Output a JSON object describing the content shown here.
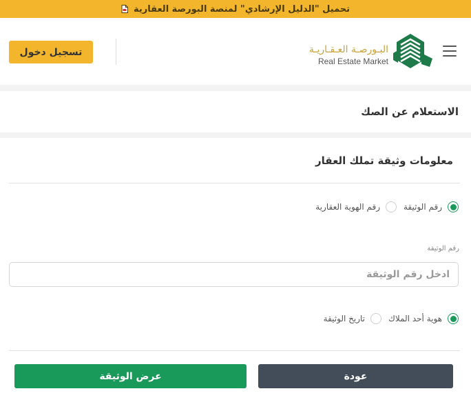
{
  "banner": {
    "text": "تحميل \"الدليل الإرشادي\" لمنصة البورصة العقارية",
    "icon": "pdf-icon"
  },
  "header": {
    "logo_ar": "البـورصـة العـقـاريـة",
    "logo_en": "Real Estate Market",
    "login_label": "تسجيل دخول",
    "menu_icon": "hamburger-menu-icon"
  },
  "page": {
    "title": "الاستعلام عن الصك"
  },
  "form": {
    "section_title": "معلومات وثيقة تملك العقار",
    "search_type_options": [
      {
        "label": "رقم الوثيقة",
        "selected": true
      },
      {
        "label": "رقم الهوية العقارية",
        "selected": false
      }
    ],
    "doc_number_label": "رقم الوثيقة",
    "doc_number_placeholder": "ادخل رقم الوثيقة",
    "doc_number_value": "",
    "verify_options": [
      {
        "label": "هوية أحد الملاك",
        "selected": true
      },
      {
        "label": "تاريخ الوثيقة",
        "selected": false
      }
    ]
  },
  "actions": {
    "view_label": "عرض الوثيقة",
    "back_label": "عودة"
  },
  "colors": {
    "accent_yellow": "#f2b52c",
    "primary_green": "#1a9a5a",
    "back_gray": "#434c59",
    "logo_gold": "#c9a23a"
  }
}
